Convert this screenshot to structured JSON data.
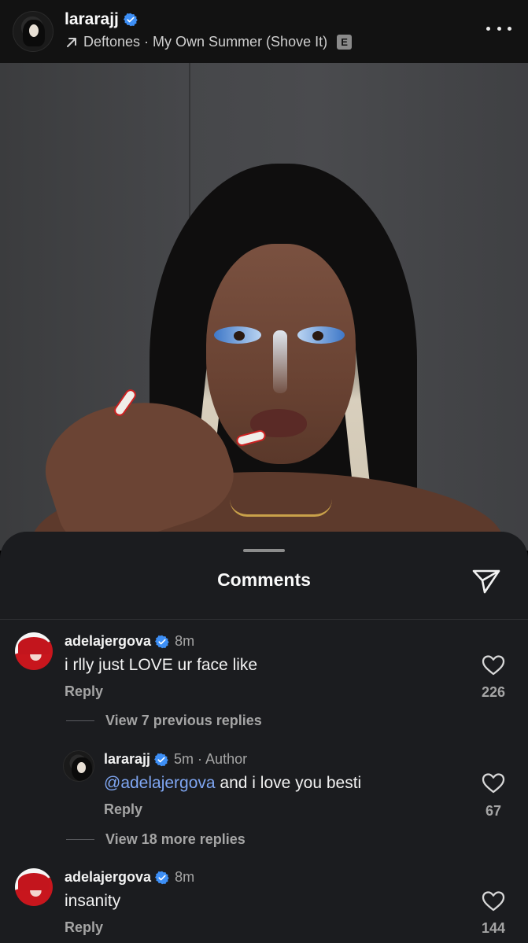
{
  "header": {
    "username": "lararajj",
    "music": "Deftones · My Own Summer (Shove It)",
    "explicit_badge": "E"
  },
  "comments_sheet": {
    "title": "Comments",
    "comments": [
      {
        "username": "adelajergova",
        "time": "8m",
        "text": "i rlly just LOVE ur face like",
        "reply_label": "Reply",
        "likes": "226"
      },
      {
        "username": "adelajergova",
        "time": "8m",
        "text": "insanity",
        "reply_label": "Reply",
        "likes": "144"
      }
    ],
    "view_previous": "View 7 previous replies",
    "author_reply": {
      "username": "lararajj",
      "meta": "5m · Author",
      "mention": "@adelajergova",
      "text": " and i love you besti",
      "reply_label": "Reply",
      "likes": "67"
    },
    "view_more": "View 18 more replies"
  },
  "colors": {
    "sheet_bg": "#1b1c1f",
    "verified_blue": "#3d8ff6",
    "mention_blue": "#7fa6f2",
    "secondary_text": "#a5a5a5"
  }
}
